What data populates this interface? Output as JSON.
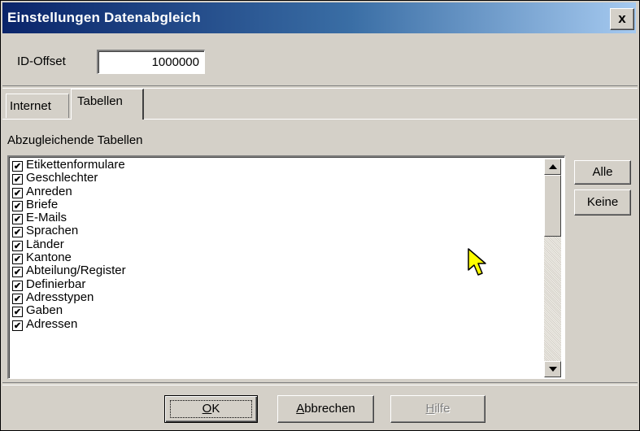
{
  "window": {
    "title": "Einstellungen Datenabgleich",
    "close_glyph": "x"
  },
  "id_offset": {
    "label": "ID-Offset",
    "value": "1000000"
  },
  "tabs": [
    {
      "label": "Internet",
      "active": false
    },
    {
      "label": "Tabellen",
      "active": true
    }
  ],
  "tables": {
    "group_label": "Abzugleichende Tabellen",
    "items": [
      {
        "label": "Etikettenformulare",
        "checked": true
      },
      {
        "label": "Geschlechter",
        "checked": true
      },
      {
        "label": "Anreden",
        "checked": true
      },
      {
        "label": "Briefe",
        "checked": true
      },
      {
        "label": "E-Mails",
        "checked": true
      },
      {
        "label": "Sprachen",
        "checked": true
      },
      {
        "label": "Länder",
        "checked": true
      },
      {
        "label": "Kantone",
        "checked": true
      },
      {
        "label": "Abteilung/Register",
        "checked": true
      },
      {
        "label": "Definierbar",
        "checked": true
      },
      {
        "label": "Adresstypen",
        "checked": true
      },
      {
        "label": "Gaben",
        "checked": true
      },
      {
        "label": "Adressen",
        "checked": true
      }
    ],
    "check_glyph": "✔",
    "buttons": {
      "all": "Alle",
      "none": "Keine"
    }
  },
  "footer": {
    "ok": {
      "mnemonic": "O",
      "rest": "K"
    },
    "cancel": {
      "mnemonic": "A",
      "rest": "bbrechen"
    },
    "help": {
      "mnemonic": "H",
      "rest": "ilfe",
      "disabled": true
    }
  },
  "colors": {
    "title_bar_start": "#0a246a",
    "title_bar_end": "#a6caf0",
    "dialog_face": "#d4d0c8",
    "cursor_fill": "#ffff00"
  }
}
